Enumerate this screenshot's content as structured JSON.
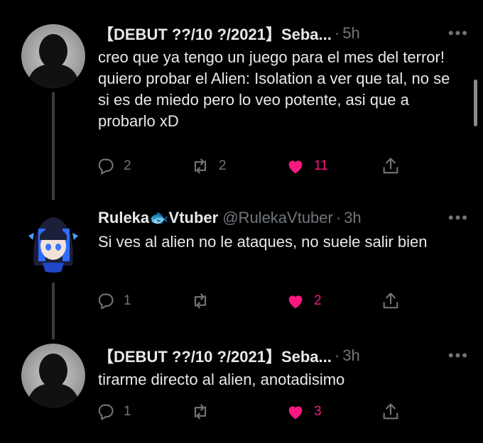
{
  "colors": {
    "background": "#000000",
    "text": "#e7e9ea",
    "muted": "#71767b",
    "like": "#f91880",
    "thread_line": "#3a3b3d"
  },
  "tweets": [
    {
      "display_name": "【DEBUT ??/10 ?/2021】Seba...",
      "handle": "",
      "dot": "·",
      "time": "5h",
      "more": "•••",
      "text": "creo que ya tengo un juego para el mes del terror! quiero probar el Alien: Isolation a ver que tal, no se si es de miedo pero lo veo potente, asi que a probarlo xD",
      "replies": "2",
      "retweets": "2",
      "likes": "11",
      "reply_icon": "reply-icon",
      "retweet_icon": "retweet-icon",
      "like_icon": "heart-icon",
      "share_icon": "share-icon"
    },
    {
      "display_name": "Ruleka🐟Vtuber",
      "handle": "@RulekaVtuber",
      "dot": "·",
      "time": "3h",
      "more": "•••",
      "text": "Si ves al alien no le ataques, no suele salir bien",
      "replies": "1",
      "retweets": "",
      "likes": "2",
      "reply_icon": "reply-icon",
      "retweet_icon": "retweet-icon",
      "like_icon": "heart-icon",
      "share_icon": "share-icon"
    },
    {
      "display_name": "【DEBUT ??/10 ?/2021】Seba...",
      "handle": "",
      "dot": "·",
      "time": "3h",
      "more": "•••",
      "text": "tirarme directo al alien, anotadisimo",
      "replies": "1",
      "retweets": "",
      "likes": "3",
      "reply_icon": "reply-icon",
      "retweet_icon": "retweet-icon",
      "like_icon": "heart-icon",
      "share_icon": "share-icon"
    }
  ]
}
